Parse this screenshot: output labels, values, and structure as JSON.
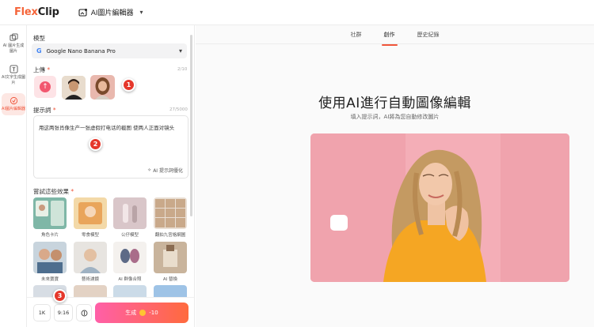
{
  "app": {
    "logo_flex": "Flex",
    "logo_clip": "Clip",
    "tool_name": "AI圖片編輯器"
  },
  "rail": {
    "items": [
      {
        "label": "AI 圖片生成圖片",
        "icon": "image-gen-icon"
      },
      {
        "label": "AI文字生成圖片",
        "icon": "text-gen-icon"
      },
      {
        "label": "AI圖片編輯器",
        "icon": "editor-icon",
        "active": true
      }
    ]
  },
  "panel": {
    "model_label": "模型",
    "model_value": "Google Nano Banana Pro",
    "upload_label": "上傳",
    "upload_counter": "2/10",
    "prompt_label": "提示詞",
    "prompt_counter": "27/5000",
    "prompt_text": "用这两张肖像生产一张虚假打电话的截图 使两人正面对镜头",
    "optimize_label": "AI 提示詞優化",
    "effects_label": "嘗試這些效果",
    "effects": [
      {
        "caption": "角色卡片"
      },
      {
        "caption": "零食模型"
      },
      {
        "caption": "公仔模型"
      },
      {
        "caption": "翻拍九宮格網圖"
      },
      {
        "caption": "未來寶寶"
      },
      {
        "caption": "藝術濾鏡"
      },
      {
        "caption": "AI 群像合照"
      },
      {
        "caption": "AI 替換"
      }
    ],
    "resolution": "1K",
    "ratio": "9:16",
    "generate_label": "生成",
    "credits": "-10"
  },
  "markers": [
    "1",
    "2",
    "3"
  ],
  "main": {
    "tabs": [
      {
        "label": "社群"
      },
      {
        "label": "創作",
        "active": true
      },
      {
        "label": "歷史紀錄"
      }
    ],
    "headline": "使用AI進行自動圖像編輯",
    "subtitle": "填入提示詞，AI將為您自動修改圖片"
  },
  "colors": {
    "accent": "#f0553a",
    "generate_gradient_start": "#ff5fa8",
    "generate_gradient_end": "#ff6a3d",
    "marker_red": "#e5372b",
    "hero_background": "#f0a3ad"
  }
}
